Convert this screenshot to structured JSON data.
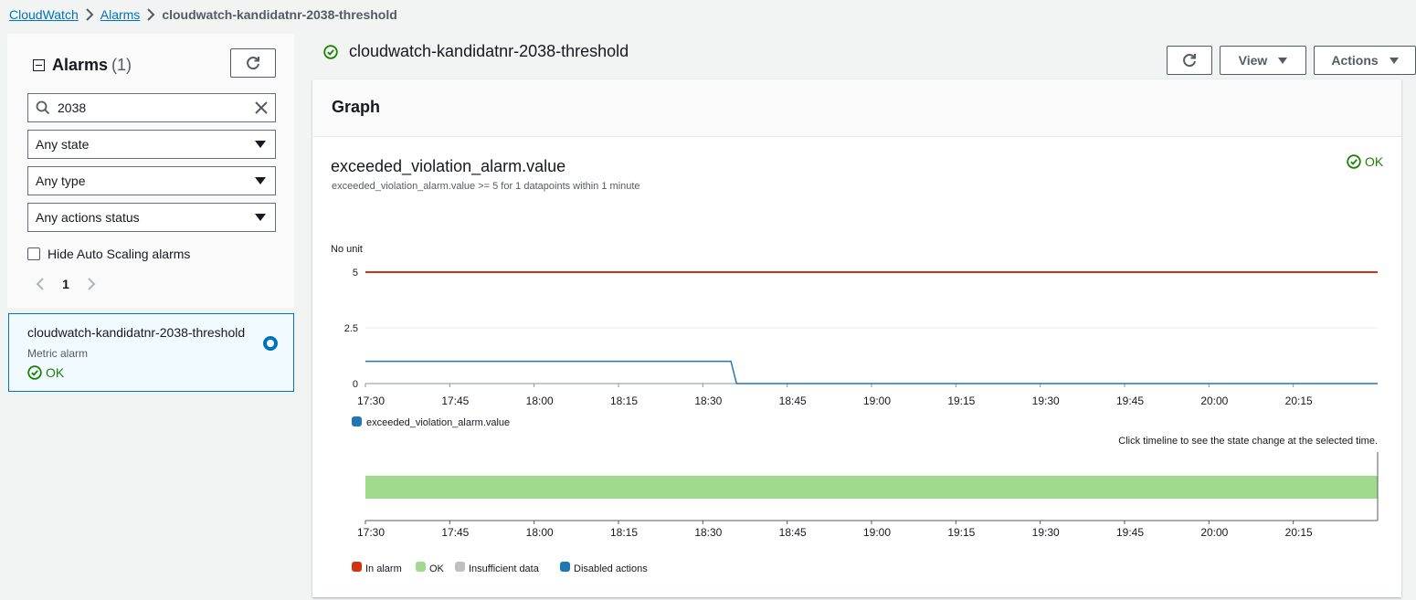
{
  "breadcrumb": {
    "items": [
      "CloudWatch",
      "Alarms"
    ],
    "current": "cloudwatch-kandidatnr-2038-threshold"
  },
  "sidebar": {
    "title": "Alarms",
    "count": "(1)",
    "search_value": "2038",
    "filters": [
      "Any state",
      "Any type",
      "Any actions status"
    ],
    "checkbox_label": "Hide Auto Scaling alarms",
    "page": "1",
    "alarm": {
      "name": "cloudwatch-kandidatnr-2038-threshold",
      "type": "Metric alarm",
      "status": "OK"
    }
  },
  "main": {
    "title": "cloudwatch-kandidatnr-2038-threshold",
    "view_label": "View",
    "actions_label": "Actions",
    "graph_header": "Graph",
    "metric_title": "exceeded_violation_alarm.value",
    "metric_subtitle": "exceeded_violation_alarm.value >= 5 for 1 datapoints within 1 minute",
    "status": "OK",
    "timeline_hint": "Click timeline to see the state change at the selected time."
  },
  "colors": {
    "ok_green": "#1d8102",
    "threshold_red": "#d13212",
    "series_blue": "#1f77b4",
    "link_blue": "#0073bb",
    "ok_band": "#a0da8c"
  },
  "chart_data": [
    {
      "type": "line",
      "ylabel": "No unit",
      "ylim": [
        0,
        5
      ],
      "y_ticks": [
        "5",
        "2.5",
        "0"
      ],
      "y_tick_values": [
        5,
        2.5,
        0
      ],
      "x_ticks": [
        "17:30",
        "17:45",
        "18:00",
        "18:15",
        "18:30",
        "18:45",
        "19:00",
        "19:15",
        "19:30",
        "19:45",
        "20:00",
        "20:15"
      ],
      "x_range": [
        "17:30",
        "20:30"
      ],
      "threshold": 5,
      "series": [
        {
          "name": "exceeded_violation_alarm.value",
          "x": [
            "17:30",
            "18:35",
            "18:36",
            "20:30"
          ],
          "values": [
            1,
            1,
            0,
            0
          ]
        }
      ],
      "legend": [
        "exceeded_violation_alarm.value"
      ]
    },
    {
      "type": "timeline",
      "x_ticks": [
        "17:30",
        "17:45",
        "18:00",
        "18:15",
        "18:30",
        "18:45",
        "19:00",
        "19:15",
        "19:30",
        "19:45",
        "20:00",
        "20:15"
      ],
      "states": [
        {
          "state": "OK",
          "from": "17:30",
          "to": "20:30"
        }
      ],
      "legend": [
        {
          "label": "In alarm",
          "color": "#d13212"
        },
        {
          "label": "OK",
          "color": "#a0da8c"
        },
        {
          "label": "Insufficient data",
          "color": "#c0c0c0"
        },
        {
          "label": "Disabled actions",
          "color": "#1f77b4"
        }
      ]
    }
  ]
}
